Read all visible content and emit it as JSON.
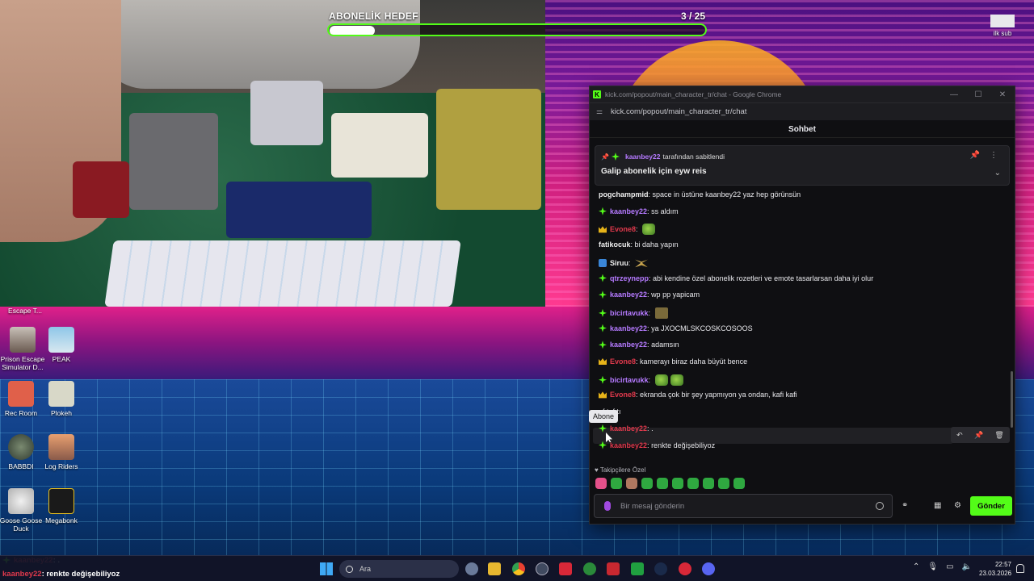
{
  "goal": {
    "title": "ABONELİK HEDEF",
    "count": "3  / 25",
    "progress_fraction": 0.12
  },
  "desktop": {
    "icons": [
      {
        "label": "Escape T..."
      },
      {
        "label": "Prison Escape Simulator D..."
      },
      {
        "label": "PEAK"
      },
      {
        "label": "Rec Room"
      },
      {
        "label": "Plokeh"
      },
      {
        "label": "BABBDI"
      },
      {
        "label": "Log Riders"
      },
      {
        "label": "Goose Goose Duck"
      },
      {
        "label": "Megabonk"
      }
    ],
    "corner_icon": {
      "label": "ilk sub"
    }
  },
  "chrome": {
    "window_title": "kick.com/popout/main_character_tr/chat - Google Chrome",
    "url": "kick.com/popout/main_character_tr/chat"
  },
  "chat": {
    "header": "Sohbet",
    "pinned": {
      "by_user": "kaanbey22",
      "by_suffix": "tarafından sabitlendi",
      "text": "Galip abonelik için eyw reis"
    },
    "messages": [
      {
        "user": "pogchampmid",
        "color": "white",
        "badge": "",
        "text": "space in üstüne kaanbey22 yaz hep görünsün"
      },
      {
        "user": "kaanbey22",
        "color": "purple",
        "badge": "sub",
        "text": "ss aldım"
      },
      {
        "user": "Evone8",
        "color": "red",
        "badge": "crown",
        "text": "",
        "emote": "frog"
      },
      {
        "user": "fatikocuk",
        "color": "white",
        "badge": "",
        "text": "bi daha yapın"
      },
      {
        "user": "Siruu",
        "color": "white",
        "badge": "blue",
        "text": "",
        "emote": "wings"
      },
      {
        "user": "qtrzeynepp",
        "color": "purple",
        "badge": "sub",
        "text": "abi kendine özel abonelik rozetleri ve emote tasarlarsan daha iyi olur"
      },
      {
        "user": "kaanbey22",
        "color": "purple",
        "badge": "sub",
        "text": "wp pp yapicam"
      },
      {
        "user": "bicirtavukk",
        "color": "purple",
        "badge": "sub",
        "text": "",
        "emote": "box"
      },
      {
        "user": "kaanbey22",
        "color": "purple",
        "badge": "sub",
        "text": "ya JXOCMLSKCOSKCOSOOS"
      },
      {
        "user": "kaanbey22",
        "color": "purple",
        "badge": "sub",
        "text": "adamsın"
      },
      {
        "user": "Evone8",
        "color": "red",
        "badge": "crown",
        "text": "kamerayı biraz daha büyüt bence"
      },
      {
        "user": "bicirtavukk",
        "color": "purple",
        "badge": "sub",
        "text": "",
        "emote": "frog"
      },
      {
        "user": "Evone8",
        "color": "red",
        "badge": "crown",
        "text": "ekranda çok bir şey yapmıyon ya ondan, kafi kafi"
      },
      {
        "user": "",
        "color": "white",
        "badge": "",
        "text": "fıtı fıtı"
      },
      {
        "user": "kaanbey22",
        "color": "red",
        "badge": "sub",
        "text": "."
      },
      {
        "user": "kaanbey22",
        "color": "red",
        "badge": "sub",
        "text": "renkte değişebiliyoz"
      }
    ],
    "tooltip": "Abone",
    "tray_label": "Takipçilere Özel",
    "input_placeholder": "Bir mesaj gönderin",
    "send_label": "Gönder"
  },
  "overlay": {
    "lines": [
      {
        "user": "kaanbey22",
        "text": "."
      },
      {
        "user": "kaanbey22",
        "text": "renkte değişebiliyoz"
      }
    ]
  },
  "taskbar": {
    "search_placeholder": "Ara",
    "time": "22:57",
    "date": "23.03.2026"
  }
}
